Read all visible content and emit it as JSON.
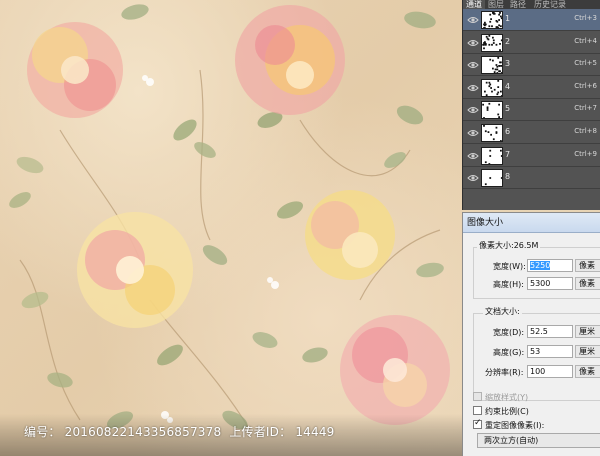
{
  "layers_panel": {
    "tabs": [
      "通道",
      "图层",
      "路径",
      "历史记录"
    ],
    "active_tab": 0,
    "layers": [
      {
        "name": "1",
        "shortcut": "Ctrl+3",
        "selected": true
      },
      {
        "name": "2",
        "shortcut": "Ctrl+4",
        "selected": false
      },
      {
        "name": "3",
        "shortcut": "Ctrl+5",
        "selected": false
      },
      {
        "name": "4",
        "shortcut": "Ctrl+6",
        "selected": false
      },
      {
        "name": "5",
        "shortcut": "Ctrl+7",
        "selected": false
      },
      {
        "name": "6",
        "shortcut": "Ctrl+8",
        "selected": false
      },
      {
        "name": "7",
        "shortcut": "Ctrl+9",
        "selected": false
      },
      {
        "name": "8",
        "shortcut": "",
        "selected": false
      }
    ]
  },
  "image_size_dialog": {
    "title": "图像大小",
    "pixel_dimensions": {
      "label": "像素大小:26.5M",
      "width_label": "宽度(W):",
      "width_value": "5250",
      "width_unit": "像素",
      "height_label": "高度(H):",
      "height_value": "5300",
      "height_unit": "像素"
    },
    "document_size": {
      "label": "文档大小:",
      "width_label": "宽度(D):",
      "width_value": "52.5",
      "width_unit": "厘米",
      "height_label": "高度(G):",
      "height_value": "53",
      "height_unit": "厘米",
      "resolution_label": "分辨率(R):",
      "resolution_value": "100",
      "resolution_unit": "像素"
    },
    "options": {
      "scale_styles": "缩放样式(Y)",
      "constrain": "约束比例(C)",
      "resample": "重定图像像素(I):",
      "resample_method": "两次立方(自动)"
    }
  },
  "caption": {
    "id_label": "编号：",
    "id_value": "20160822143356857378",
    "uploader_label": "上传者ID：",
    "uploader_value": "14449"
  },
  "colors": {
    "panel_bg": "#535353",
    "selection": "#5b6c85",
    "dialog_bg": "#f0f0f0",
    "field_highlight": "#3399ff"
  }
}
